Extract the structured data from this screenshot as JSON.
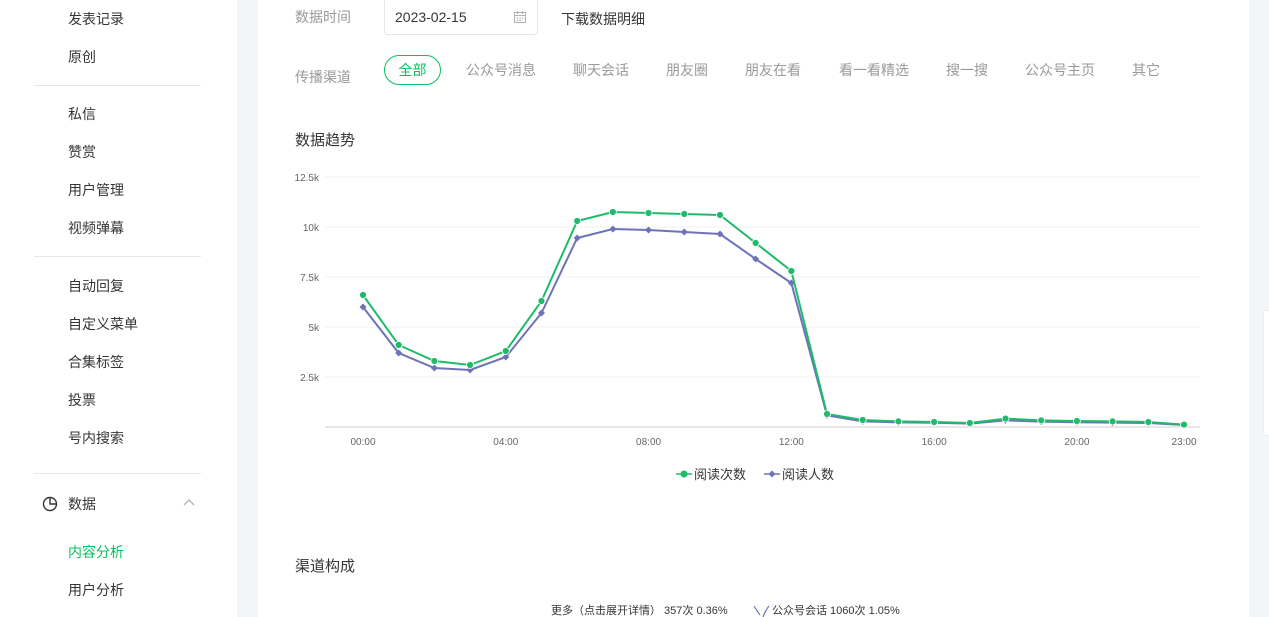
{
  "sidebar": {
    "items": [
      {
        "label": "发表记录"
      },
      {
        "label": "原创"
      },
      {
        "label": "私信"
      },
      {
        "label": "赞赏"
      },
      {
        "label": "用户管理"
      },
      {
        "label": "视频弹幕"
      },
      {
        "label": "自动回复"
      },
      {
        "label": "自定义菜单"
      },
      {
        "label": "合集标签"
      },
      {
        "label": "投票"
      },
      {
        "label": "号内搜索"
      }
    ],
    "section": {
      "label": "数据",
      "icon": "pie-chart-icon"
    },
    "sub_items": [
      {
        "label": "内容分析",
        "active": true
      },
      {
        "label": "用户分析"
      }
    ]
  },
  "filters": {
    "date_label": "数据时间",
    "date_value": "2023-02-15",
    "download_label": "下载数据明细",
    "channel_label": "传播渠道",
    "channels": [
      "全部",
      "公众号消息",
      "聊天会话",
      "朋友圈",
      "朋友在看",
      "看一看精选",
      "搜一搜",
      "公众号主页",
      "其它"
    ],
    "active_channel": "全部"
  },
  "trend": {
    "title": "数据趋势"
  },
  "composition": {
    "title": "渠道构成",
    "labels": [
      "更多（点击展开详情） 357次 0.36%",
      "公众号会话 1060次 1.05%"
    ]
  },
  "colors": {
    "accent": "#07c160",
    "series_reads": "#1ebb6a",
    "series_readers": "#6e73b7"
  },
  "chart_data": {
    "type": "line",
    "xlabel": "",
    "ylabel": "",
    "x": [
      "00:00",
      "01:00",
      "02:00",
      "03:00",
      "04:00",
      "05:00",
      "06:00",
      "07:00",
      "08:00",
      "09:00",
      "10:00",
      "11:00",
      "12:00",
      "13:00",
      "14:00",
      "15:00",
      "16:00",
      "17:00",
      "18:00",
      "19:00",
      "20:00",
      "21:00",
      "22:00",
      "23:00"
    ],
    "x_tick_labels": [
      "00:00",
      "04:00",
      "08:00",
      "12:00",
      "16:00",
      "20:00",
      "23:00"
    ],
    "x_tick_indices": [
      0,
      4,
      8,
      12,
      16,
      20,
      23
    ],
    "y_ticks": [
      2500,
      5000,
      7500,
      10000,
      12500
    ],
    "y_tick_labels": [
      "2.5k",
      "5k",
      "7.5k",
      "10k",
      "12.5k"
    ],
    "ylim": [
      0,
      12500
    ],
    "grid": true,
    "legend": "bottom",
    "series": [
      {
        "name": "阅读次数",
        "color": "#1ebb6a",
        "marker": "circle",
        "values": [
          6600,
          4100,
          3300,
          3100,
          3800,
          6300,
          10300,
          10750,
          10700,
          10650,
          10600,
          9200,
          7800,
          650,
          350,
          280,
          250,
          200,
          420,
          330,
          300,
          280,
          250,
          120
        ]
      },
      {
        "name": "阅读人数",
        "color": "#6e73b7",
        "marker": "diamond",
        "values": [
          6000,
          3700,
          2950,
          2850,
          3500,
          5700,
          9450,
          9900,
          9850,
          9750,
          9650,
          8400,
          7200,
          580,
          280,
          230,
          210,
          170,
          330,
          270,
          240,
          220,
          200,
          100
        ]
      }
    ]
  }
}
